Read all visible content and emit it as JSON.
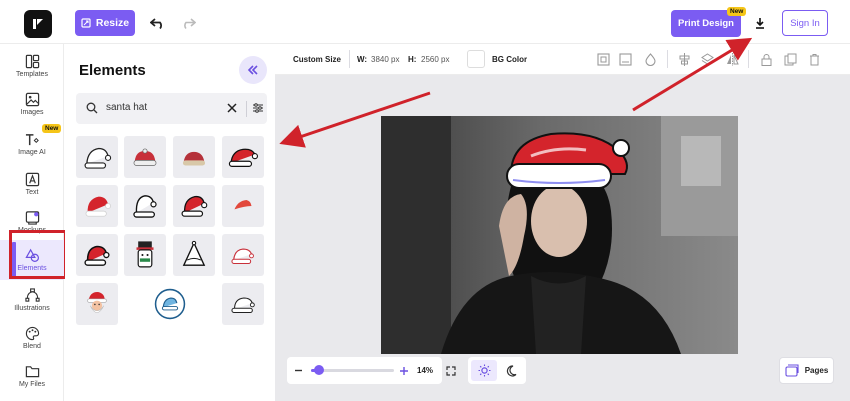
{
  "topbar": {
    "resize_label": "Resize",
    "print_label": "Print Design",
    "print_badge": "New",
    "signin_label": "Sign In"
  },
  "rail": {
    "items": [
      {
        "label": "Templates",
        "icon": "templates-icon"
      },
      {
        "label": "Images",
        "icon": "image-icon"
      },
      {
        "label": "Image AI",
        "icon": "text-image-ai-icon",
        "badge": "New"
      },
      {
        "label": "Text",
        "icon": "text-icon"
      },
      {
        "label": "Mockups",
        "icon": "mockup-icon"
      },
      {
        "label": "Elements",
        "icon": "shapes-icon",
        "active": true
      },
      {
        "label": "Illustrations",
        "icon": "illustration-icon"
      },
      {
        "label": "Blend",
        "icon": "palette-icon"
      },
      {
        "label": "My Files",
        "icon": "folder-icon"
      }
    ]
  },
  "panel": {
    "title": "Elements",
    "search_value": "santa hat",
    "results_count": 16
  },
  "toolbar": {
    "custom_size_label": "Custom Size",
    "width_label": "W:",
    "width_value": "3840 px",
    "height_label": "H:",
    "height_value": "2560 px",
    "bg_label": "BG Color"
  },
  "zoom": {
    "value": "14%",
    "level_fraction": 0.1
  },
  "pages_label": "Pages",
  "colors": {
    "accent": "#7b5cf2",
    "annotation": "#d0222a",
    "hat_red": "#d4242c"
  }
}
